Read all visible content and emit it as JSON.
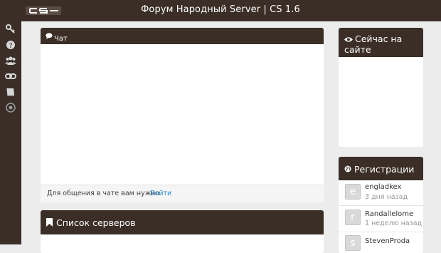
{
  "header": {
    "logo": "CS",
    "title": "Форум Народный Server | CS 1.6"
  },
  "sidebar": {
    "icons": [
      "key-icon",
      "help-icon",
      "users-icon",
      "link-icon",
      "book-icon",
      "circle-icon"
    ]
  },
  "chat": {
    "title": "Чат",
    "footer_text": "Для общения в чате вам нужно",
    "login_link": "Войти"
  },
  "servers": {
    "title": "Список серверов"
  },
  "online": {
    "title_line1": "Сейчас на",
    "title_line2": "сайте"
  },
  "registrations": {
    "title": "Регистрации",
    "users": [
      {
        "letter": "e",
        "name": "engladkex",
        "date": "3 дня назад"
      },
      {
        "letter": "r",
        "name": "Randallelome",
        "date": "1 неделю назад"
      },
      {
        "letter": "s",
        "name": "StevenProda",
        "date": ""
      }
    ]
  },
  "colors": {
    "dark": "#3a2e26",
    "link": "#2a8fd0",
    "background": "#ececec"
  }
}
